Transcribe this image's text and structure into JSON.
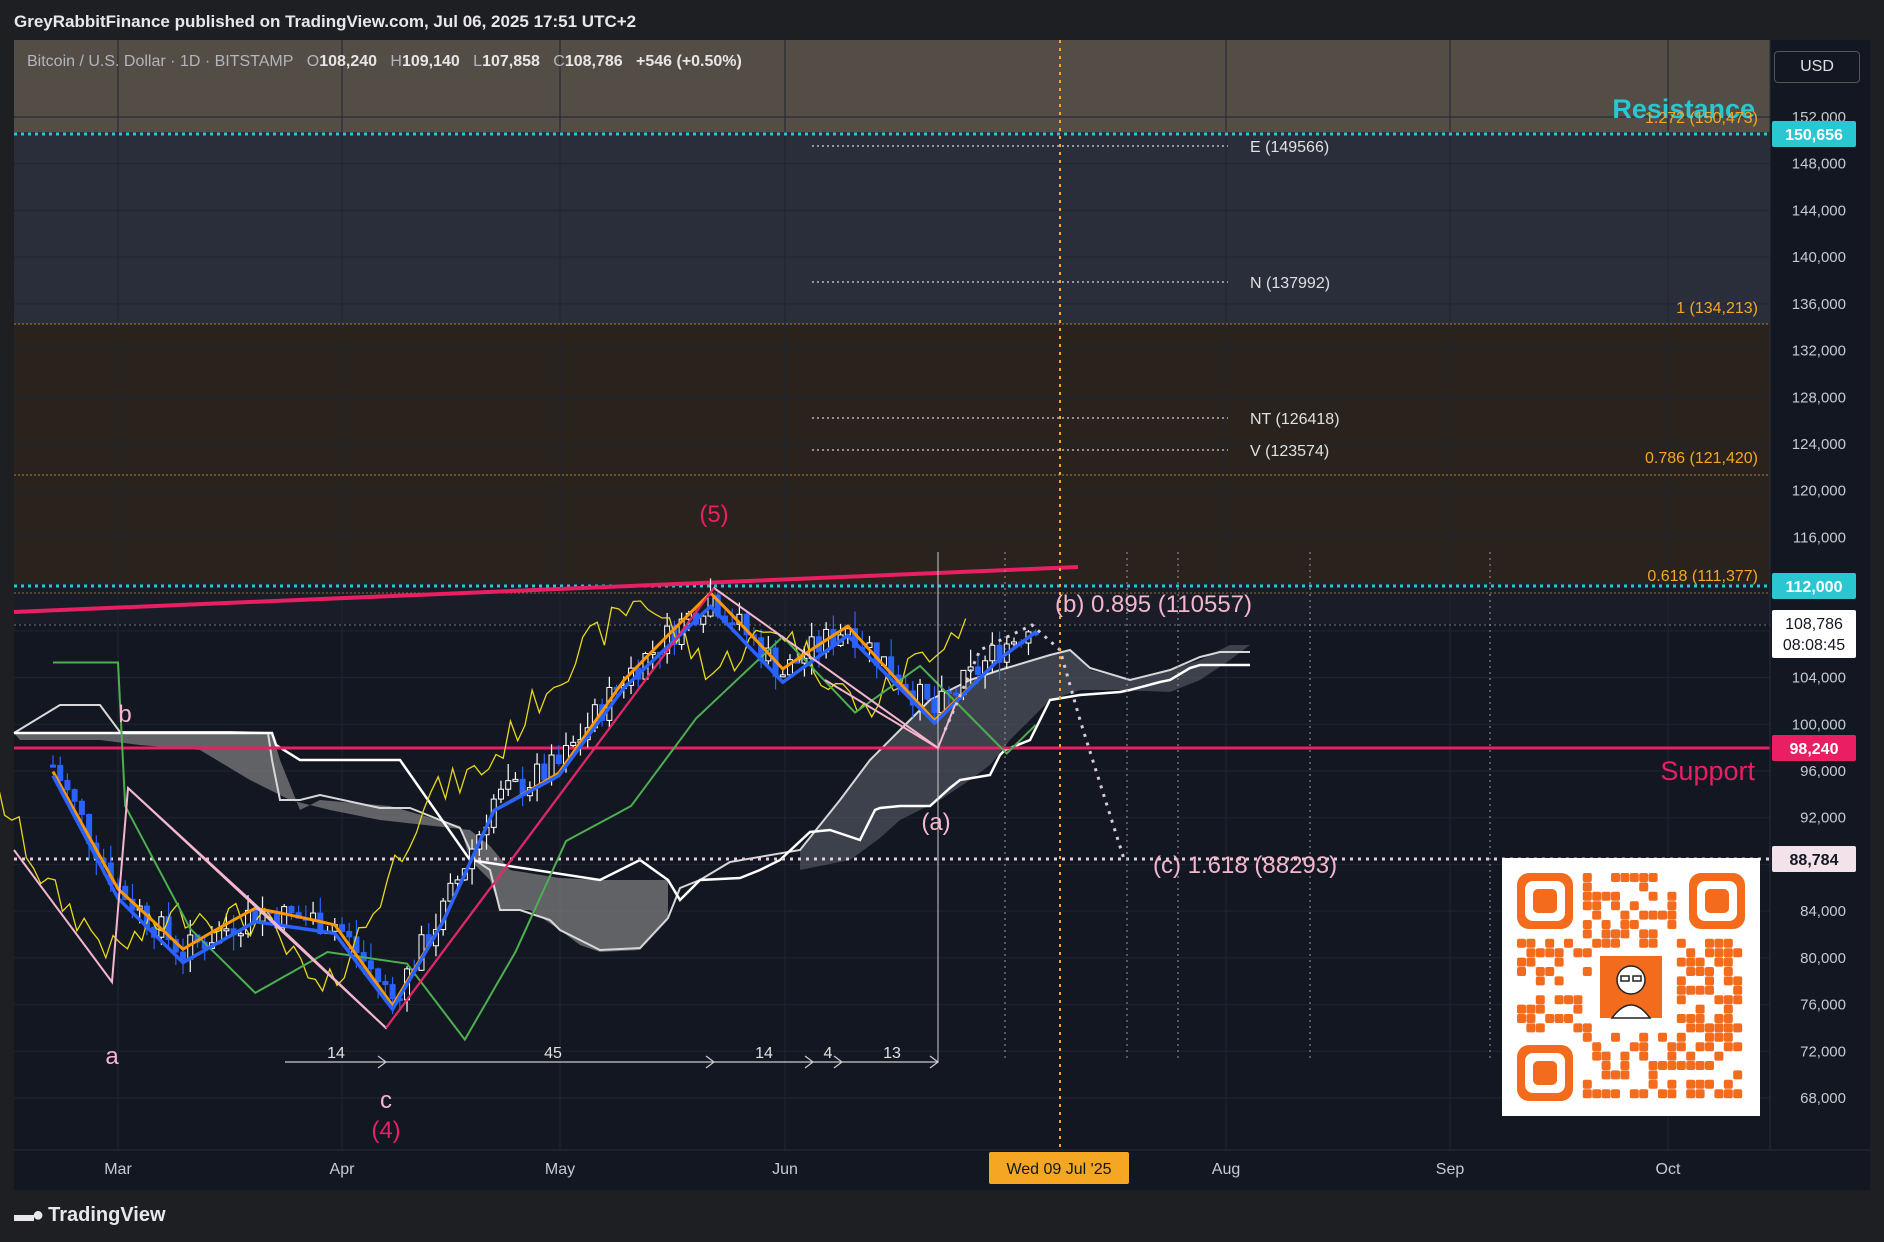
{
  "publish_line": "GreyRabbitFinance published on TradingView.com, Jul 06, 2025 17:51 UTC+2",
  "legend": {
    "symbol": "Bitcoin / U.S. Dollar · 1D · BITSTAMP",
    "o_label": "O",
    "o": "108,240",
    "h_label": "H",
    "h": "109,140",
    "l_label": "L",
    "l": "107,858",
    "c_label": "C",
    "c": "108,786",
    "change": "+546 (+0.50%)"
  },
  "currency": "USD",
  "price_tags": {
    "resistance": "150,656",
    "level_112": "112,000",
    "last_price": "108,786",
    "countdown": "08:08:45",
    "support": "98,240",
    "target": "88,784"
  },
  "colors": {
    "background": "#131722",
    "resistance_zone": "#5c5349",
    "mid_zone": "#2a2e3b",
    "brown_zone": "#2a231d",
    "resistance_color": "#29c7d1",
    "support_color": "#e91e63",
    "fib_color": "#f5a623",
    "cloud_fill": "#8a8a8a",
    "tenkan": "#2962ff",
    "kijun": "#ff9800",
    "chikou": "#e8d81a",
    "span_b": "#4caf50"
  },
  "text_labels": {
    "resistance": "Resistance",
    "support": "Support",
    "fib_1272": "1.272 (150,473)",
    "fib_1": "1 (134,213)",
    "fib_0786": "0.786 (121,420)",
    "fib_0618": "0.618 (111,377)",
    "E": "E (149566)",
    "N": "N (137992)",
    "NT": "NT (126418)",
    "V": "V (123574)",
    "wave_5": "(5)",
    "wave_4": "(4)",
    "wave_b_big": "(b) 0.895 (110557)",
    "wave_a_small": "(a)",
    "wave_c_target": "(c) 1.618 (88293)",
    "wave_a": "a",
    "wave_b": "b",
    "wave_c": "c",
    "count_14a": "14",
    "count_45": "45",
    "count_14b": "14",
    "count_4": "4",
    "count_13": "13",
    "date_badge": "Wed 09 Jul '25"
  },
  "tv_logo": "TradingView",
  "chart_data": {
    "type": "candlestick",
    "title": "Bitcoin / U.S. Dollar · 1D · BITSTAMP",
    "x_ticks": [
      "Mar",
      "Apr",
      "May",
      "Jun",
      "Aug",
      "Sep",
      "Oct"
    ],
    "y_ticks": [
      68000,
      72000,
      76000,
      80000,
      84000,
      88000,
      92000,
      96000,
      100000,
      104000,
      108000,
      112000,
      116000,
      120000,
      124000,
      128000,
      132000,
      136000,
      140000,
      144000,
      148000,
      152000
    ],
    "ylim": [
      65000,
      156000
    ],
    "last_close": 108786,
    "levels": {
      "resistance": 150656,
      "fib_1272": 150473,
      "E": 149566,
      "N": 137992,
      "fib_1": 134213,
      "NT": 126418,
      "V": 123574,
      "fib_0786": 121420,
      "fib_0618": 111377,
      "level_112": 112000,
      "support": 98240,
      "target": 88784,
      "target_c": 88293,
      "wave_b": 110557
    },
    "close_series_dates": [
      "2025-02-20",
      "2025-03-01",
      "2025-03-10",
      "2025-03-20",
      "2025-03-31",
      "2025-04-08",
      "2025-04-15",
      "2025-04-22",
      "2025-05-01",
      "2025-05-10",
      "2025-05-22",
      "2025-06-01",
      "2025-06-10",
      "2025-06-22",
      "2025-07-01",
      "2025-07-06"
    ],
    "close_series": [
      96500,
      86000,
      80500,
      84000,
      83000,
      76500,
      84000,
      93500,
      96500,
      104000,
      111000,
      104500,
      108500,
      101000,
      106500,
      108786
    ],
    "grid": true,
    "legend": "top-left"
  }
}
